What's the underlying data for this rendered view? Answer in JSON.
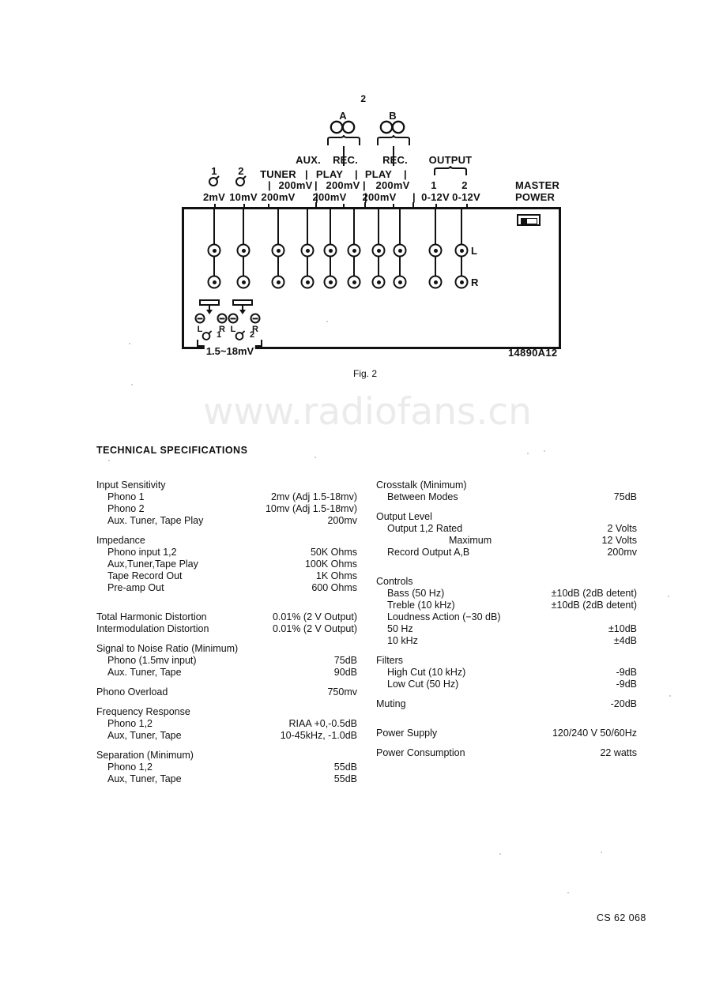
{
  "page": {
    "number": "2",
    "footer_code": "CS 62 068",
    "watermark": "www.radiofans.cn"
  },
  "figure": {
    "caption": "Fig. 2",
    "drawing_number": "14890A12",
    "master_power_label_line1": "MASTER",
    "master_power_label_line2": "POWER",
    "row_label_left": "L",
    "row_label_right": "R",
    "range_bracket_label": "1.5~18mV",
    "groups": {
      "phono1_number": "1",
      "phono2_number": "2",
      "phono1_level": "2mV",
      "phono2_level": "10mV",
      "tuner": "TUNER",
      "tuner_level": "200mV",
      "aux": "AUX.",
      "aux_level": "200mV",
      "play_a": "PLAY",
      "play_a_level": "200mV",
      "rec_a": "REC.",
      "rec_a_level": "200mV",
      "play_b": "PLAY",
      "play_b_level": "200mV",
      "rec_b": "REC.",
      "rec_b_level": "200mV",
      "deck_a": "A",
      "deck_b": "B",
      "output": "OUTPUT",
      "output1_number": "1",
      "output2_number": "2",
      "output1_level": "0-12V",
      "output2_level": "0-12V"
    },
    "trimmers": {
      "left_L": "L",
      "left_R": "R",
      "right_L": "L",
      "right_R": "R",
      "phono1_index": "1",
      "phono2_index": "2"
    }
  },
  "specifications": {
    "title": "TECHNICAL SPECIFICATIONS",
    "left_column": [
      {
        "type": "head",
        "key": "Input Sensitivity",
        "value": ""
      },
      {
        "type": "indent",
        "key": "Phono 1",
        "value": "2mv (Adj 1.5-18mv)"
      },
      {
        "type": "indent",
        "key": "Phono 2",
        "value": "10mv (Adj 1.5-18mv)"
      },
      {
        "type": "indent",
        "key": "Aux. Tuner, Tape Play",
        "value": "200mv"
      },
      {
        "type": "gap",
        "key": "",
        "value": ""
      },
      {
        "type": "head",
        "key": "Impedance",
        "value": ""
      },
      {
        "type": "indent",
        "key": "Phono input 1,2",
        "value": "50K Ohms"
      },
      {
        "type": "indent",
        "key": "Aux,Tuner,Tape Play",
        "value": "100K Ohms"
      },
      {
        "type": "indent",
        "key": "Tape Record Out",
        "value": "1K Ohms"
      },
      {
        "type": "indent",
        "key": "Pre-amp Out",
        "value": "600 Ohms"
      },
      {
        "type": "gap-xl",
        "key": "",
        "value": ""
      },
      {
        "type": "head",
        "key": "Total Harmonic Distortion",
        "value": "0.01%  (2 V Output)"
      },
      {
        "type": "head",
        "key": "Intermodulation Distortion",
        "value": "0.01%  (2 V Output)"
      },
      {
        "type": "gap",
        "key": "",
        "value": ""
      },
      {
        "type": "head",
        "key": "Signal to Noise Ratio (Minimum)",
        "value": ""
      },
      {
        "type": "indent",
        "key": "Phono (1.5mv input)",
        "value": "75dB"
      },
      {
        "type": "indent",
        "key": "Aux. Tuner, Tape",
        "value": "90dB"
      },
      {
        "type": "gap",
        "key": "",
        "value": ""
      },
      {
        "type": "head",
        "key": "Phono Overload",
        "value": "750mv"
      },
      {
        "type": "gap",
        "key": "",
        "value": ""
      },
      {
        "type": "head",
        "key": "Frequency Response",
        "value": ""
      },
      {
        "type": "indent",
        "key": "Phono 1,2",
        "value": "RIAA +0,-0.5dB"
      },
      {
        "type": "indent",
        "key": "Aux, Tuner, Tape",
        "value": "10-45kHz, -1.0dB"
      },
      {
        "type": "gap",
        "key": "",
        "value": ""
      },
      {
        "type": "head",
        "key": "Separation (Minimum)",
        "value": ""
      },
      {
        "type": "indent",
        "key": "Phono 1,2",
        "value": "55dB"
      },
      {
        "type": "indent",
        "key": "Aux, Tuner, Tape",
        "value": "55dB"
      }
    ],
    "right_column": [
      {
        "type": "head",
        "key": "Crosstalk (Minimum)",
        "value": ""
      },
      {
        "type": "indent",
        "key": "Between Modes",
        "value": "75dB"
      },
      {
        "type": "gap",
        "key": "",
        "value": ""
      },
      {
        "type": "head",
        "key": "Output Level",
        "value": ""
      },
      {
        "type": "indent",
        "key": "Output 1,2 Rated",
        "value": "2 Volts"
      },
      {
        "type": "indent2",
        "key": "Maximum",
        "value": "12 Volts"
      },
      {
        "type": "indent",
        "key": "Record Output A,B",
        "value": "200mv"
      },
      {
        "type": "gap-xl",
        "key": "",
        "value": ""
      },
      {
        "type": "head",
        "key": "Controls",
        "value": ""
      },
      {
        "type": "indent",
        "key": "Bass (50 Hz)",
        "value": "±10dB (2dB detent)"
      },
      {
        "type": "indent",
        "key": "Treble (10 kHz)",
        "value": "±10dB (2dB detent)"
      },
      {
        "type": "indent",
        "key": "Loudness Action (−30 dB)",
        "value": ""
      },
      {
        "type": "indent",
        "key": "50 Hz",
        "value": "±10dB"
      },
      {
        "type": "indent",
        "key": "10 kHz",
        "value": "±4dB"
      },
      {
        "type": "gap",
        "key": "",
        "value": ""
      },
      {
        "type": "head",
        "key": "Filters",
        "value": ""
      },
      {
        "type": "indent",
        "key": "High Cut (10 kHz)",
        "value": "-9dB"
      },
      {
        "type": "indent",
        "key": "Low Cut (50 Hz)",
        "value": "-9dB"
      },
      {
        "type": "gap",
        "key": "",
        "value": ""
      },
      {
        "type": "head",
        "key": "Muting",
        "value": "-20dB"
      },
      {
        "type": "gap-xl",
        "key": "",
        "value": ""
      },
      {
        "type": "head",
        "key": "Power Supply",
        "value": "120/240 V 50/60Hz"
      },
      {
        "type": "gap",
        "key": "",
        "value": ""
      },
      {
        "type": "head",
        "key": "Power Consumption",
        "value": "22 watts"
      }
    ]
  }
}
